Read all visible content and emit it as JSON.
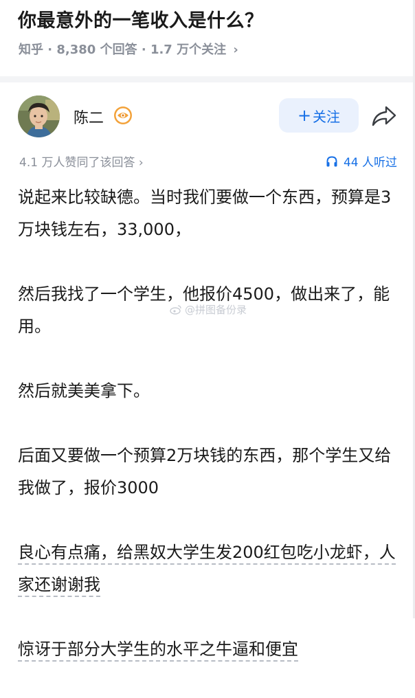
{
  "question": {
    "title": "你最意外的一笔收入是什么？",
    "meta": "知乎 · 8,380 个回答 · 1.7 万个关注",
    "meta_chevron": "›"
  },
  "author": {
    "name": "陈二",
    "avatar_icon": "avatar-photo",
    "badge_icon": "eye-badge-icon"
  },
  "actions": {
    "follow_plus": "+",
    "follow_label": "关注",
    "share_icon": "share-arrow-icon"
  },
  "answer_meta": {
    "upvotes": "4.1 万人赞同了该回答 ›",
    "listen_count": "44 人听过",
    "listen_icon": "headphones-icon"
  },
  "answer": {
    "paragraphs": [
      "说起来比较缺德。当时我们要做一个东西，预算是3万块钱左右，33,000，",
      "然后我找了一个学生，他报价4500，做出来了，能用。",
      "然后就美美拿下。",
      "后面又要做一个预算2万块钱的东西，那个学生又给我做了，报价3000",
      "良心有点痛，给黑奴大学生发200红包吃小龙虾，人家还谢谢我",
      "惊讶于部分大学生的水平之牛逼和便宜"
    ]
  },
  "watermark": {
    "text": "@拼图备份录",
    "icon": "weibo-icon"
  },
  "colors": {
    "accent": "#1770e6",
    "follow_bg": "#eaf1fd",
    "meta_gray": "#8a8f99",
    "separator": "#f3f4f6",
    "text": "#1a1a1a"
  }
}
